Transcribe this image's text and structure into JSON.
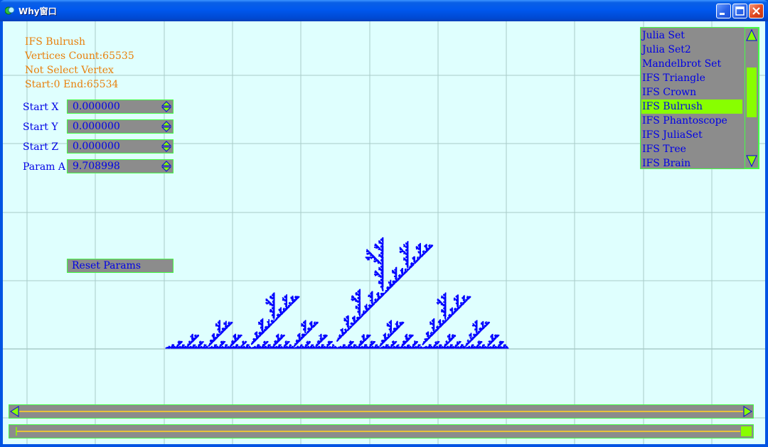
{
  "window": {
    "title": "Why窗口"
  },
  "info": {
    "line1": "IFS Bulrush",
    "line2": "Vertices Count:65535",
    "line3": "Not Select Vertex",
    "line4": "Start:0 End:65534"
  },
  "params": [
    {
      "label": "Start X",
      "value": "0.000000"
    },
    {
      "label": "Start Y",
      "value": "0.000000"
    },
    {
      "label": "Start Z",
      "value": "0.000000"
    },
    {
      "label": "Param A",
      "value": "9.708998"
    }
  ],
  "reset_label": "Reset Params",
  "list": {
    "items": [
      "Julia Set",
      "Julia Set2",
      "Mandelbrot Set",
      "IFS Triangle",
      "IFS Crown",
      "IFS Bulrush",
      "IFS Phantoscope",
      "IFS JuliaSet",
      "IFS Tree",
      "IFS Brain"
    ],
    "selected": "IFS Bulrush"
  },
  "colors": {
    "background": "#dffffe",
    "grid": "#a9cbc8",
    "fractal": "#0000ff",
    "info_text": "#e87f0a",
    "label_text": "#0000e6",
    "control_fill": "#8c8c8c",
    "control_border": "#44ff44",
    "accent": "#88ff00"
  },
  "icons": {
    "spinner": "up-down-arrows-icon",
    "scroll_left": "left-arrow-icon",
    "scroll_right": "right-arrow-icon",
    "scroll_up": "up-arrow-icon",
    "scroll_down": "down-arrow-icon"
  },
  "scrollbars": {
    "horizontal_1_position": 0.0,
    "horizontal_2_position": 1.0,
    "list_scroll_position": 0.35
  }
}
